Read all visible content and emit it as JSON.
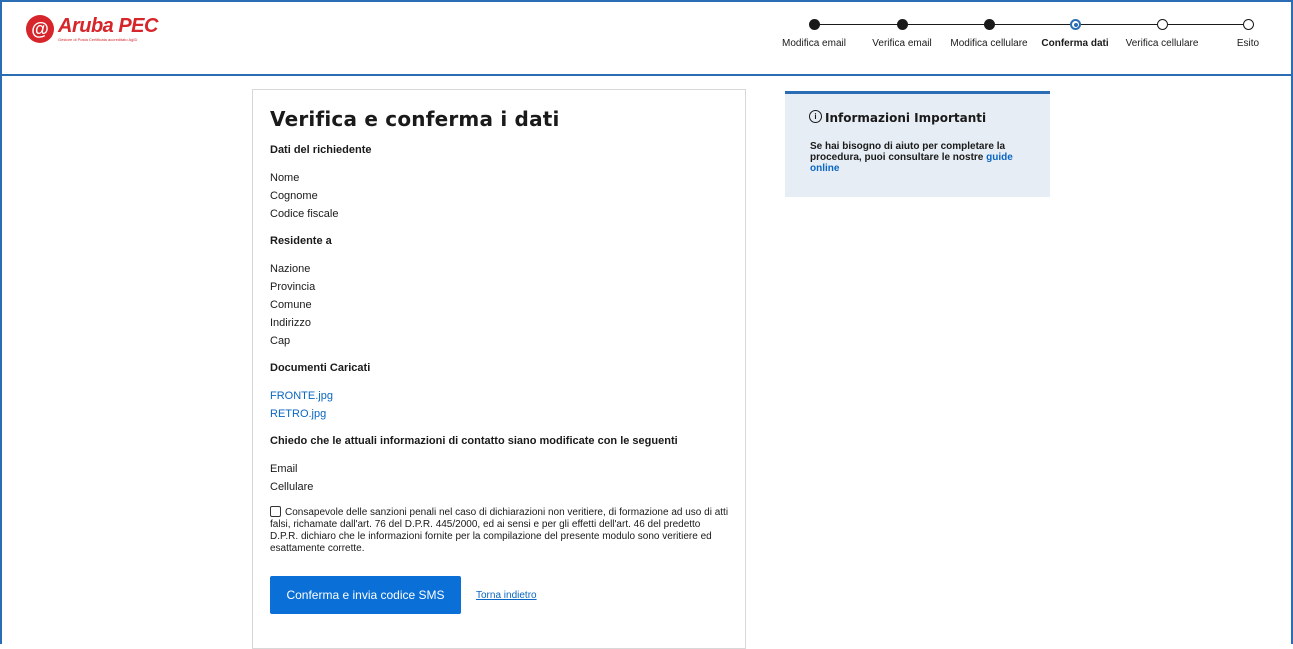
{
  "brand": {
    "logo_symbol": "@",
    "name": "Aruba PEC",
    "tagline": "Gestore di Posta Certificata accreditato AgID",
    "color": "#d6262b"
  },
  "stepper": {
    "steps": [
      {
        "label": "Modifica email",
        "state": "done"
      },
      {
        "label": "Verifica email",
        "state": "done"
      },
      {
        "label": "Modifica cellulare",
        "state": "done"
      },
      {
        "label": "Conferma dati",
        "state": "current"
      },
      {
        "label": "Verifica cellulare",
        "state": "todo"
      },
      {
        "label": "Esito",
        "state": "todo"
      }
    ]
  },
  "main": {
    "title": "Verifica e conferma i dati",
    "applicant": {
      "title": "Dati del richiedente",
      "fields": [
        "Nome",
        "Cognome",
        "Codice fiscale"
      ]
    },
    "residence": {
      "title": "Residente a",
      "fields": [
        "Nazione",
        "Provincia",
        "Comune",
        "Indirizzo",
        "Cap"
      ]
    },
    "documents": {
      "title": "Documenti Caricati",
      "files": [
        "FRONTE.jpg",
        "RETRO.jpg"
      ]
    },
    "contacts": {
      "title": "Chiedo che le attuali informazioni di contatto siano modificate con le seguenti",
      "fields": [
        "Email",
        "Cellulare"
      ]
    },
    "consent_text": "Consapevole delle sanzioni penali nel caso di dichiarazioni non veritiere, di formazione ad uso di atti falsi, richamate dall'art. 76 del D.P.R. 445/2000, ed ai sensi e per gli effetti dell'art. 46 del predetto D.P.R. dichiaro che le informazioni fornite per la compilazione del presente modulo sono veritiere ed esattamente corrette.",
    "confirm_button": "Conferma e invia codice SMS",
    "back_link": "Torna indietro"
  },
  "info": {
    "icon": "info-icon",
    "icon_glyph": "i",
    "title": "Informazioni Importanti",
    "text": "Se hai bisogno di aiuto per completare la procedura, puoi consultare le nostre",
    "link": "guide online"
  },
  "colors": {
    "accent": "#2a6db5",
    "button": "#0a6fd6",
    "link": "#0a66c2",
    "info_bg": "#e6edf5"
  }
}
